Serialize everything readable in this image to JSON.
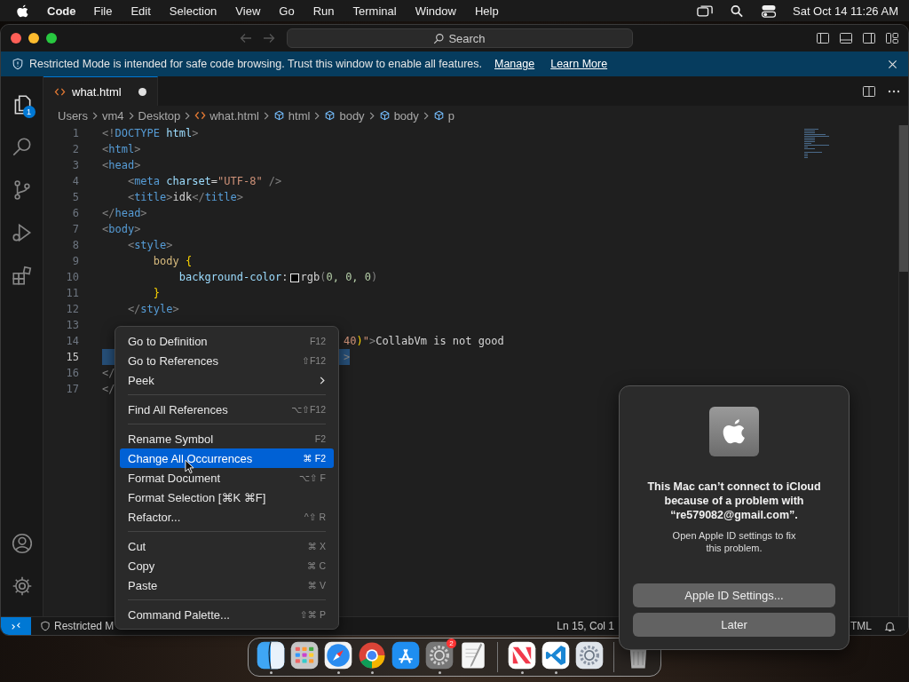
{
  "menubar": {
    "app_name": "Code",
    "menus": [
      "File",
      "Edit",
      "Selection",
      "View",
      "Go",
      "Run",
      "Terminal",
      "Window",
      "Help"
    ],
    "clock": "Sat Oct 14  11:26 AM"
  },
  "titlebar": {
    "search": "Search",
    "back_disabled": true,
    "forward_disabled": true
  },
  "banner": {
    "text": "Restricted Mode is intended for safe code browsing. Trust this window to enable all features.",
    "links": [
      "Manage",
      "Learn More"
    ]
  },
  "activity_bar": [
    {
      "kind": "explorer",
      "selected": true,
      "badge": "1"
    },
    {
      "kind": "search",
      "selected": false
    },
    {
      "kind": "source-control",
      "selected": false
    },
    {
      "kind": "run",
      "selected": false
    },
    {
      "kind": "extensions",
      "selected": false
    }
  ],
  "activity_bottom": [
    {
      "kind": "account"
    },
    {
      "kind": "manage"
    }
  ],
  "tabs": [
    {
      "label": "what.html",
      "selected": true,
      "dirty": true
    }
  ],
  "breadcrumb": [
    {
      "label": "Users",
      "kind": "folder"
    },
    {
      "label": "vm4",
      "kind": "folder"
    },
    {
      "label": "Desktop",
      "kind": "folder"
    },
    {
      "label": "what.html",
      "kind": "file"
    },
    {
      "label": "html",
      "kind": "symbol"
    },
    {
      "label": "body",
      "kind": "symbol"
    },
    {
      "label": "body",
      "kind": "symbol"
    },
    {
      "label": "p",
      "kind": "symbol"
    }
  ],
  "code": [
    {
      "n": "1",
      "tokens": [
        {
          "t": "<!",
          "kind": "punct"
        },
        {
          "t": "DOCTYPE",
          "kind": "tag"
        },
        {
          "t": " html",
          "kind": "attr"
        },
        {
          "t": ">",
          "kind": "punct"
        }
      ]
    },
    {
      "n": "2",
      "tokens": [
        {
          "t": "<",
          "kind": "punct"
        },
        {
          "t": "html",
          "kind": "tag"
        },
        {
          "t": ">",
          "kind": "punct"
        }
      ]
    },
    {
      "n": "3",
      "tokens": [
        {
          "t": "<",
          "kind": "punct"
        },
        {
          "t": "head",
          "kind": "tag"
        },
        {
          "t": ">",
          "kind": "punct"
        }
      ]
    },
    {
      "n": "4",
      "tokens": [
        {
          "t": "    <",
          "kind": "punct"
        },
        {
          "t": "meta",
          "kind": "tag"
        },
        {
          "t": " charset",
          "kind": "attr"
        },
        {
          "t": "=",
          "kind": "text"
        },
        {
          "t": "\"UTF-8\"",
          "kind": "str"
        },
        {
          "t": " />",
          "kind": "punct"
        }
      ]
    },
    {
      "n": "5",
      "tokens": [
        {
          "t": "    <",
          "kind": "punct"
        },
        {
          "t": "title",
          "kind": "tag"
        },
        {
          "t": ">",
          "kind": "punct"
        },
        {
          "t": "idk",
          "kind": "text"
        },
        {
          "t": "</",
          "kind": "punct"
        },
        {
          "t": "title",
          "kind": "tag"
        },
        {
          "t": ">",
          "kind": "punct"
        }
      ]
    },
    {
      "n": "6",
      "tokens": [
        {
          "t": "</",
          "kind": "punct"
        },
        {
          "t": "head",
          "kind": "tag"
        },
        {
          "t": ">",
          "kind": "punct"
        }
      ]
    },
    {
      "n": "7",
      "tokens": [
        {
          "t": "<",
          "kind": "punct"
        },
        {
          "t": "body",
          "kind": "tag"
        },
        {
          "t": ">",
          "kind": "punct"
        }
      ]
    },
    {
      "n": "8",
      "tokens": [
        {
          "t": "    <",
          "kind": "punct"
        },
        {
          "t": "style",
          "kind": "tag"
        },
        {
          "t": ">",
          "kind": "punct"
        }
      ]
    },
    {
      "n": "9",
      "tokens": [
        {
          "t": "        body",
          "kind": "selector"
        },
        {
          "t": " {",
          "kind": "brace"
        }
      ]
    },
    {
      "n": "10",
      "tokens": [
        {
          "t": "            background-color",
          "kind": "attr"
        },
        {
          "t": ":",
          "kind": "text"
        },
        {
          "kind": "swatch"
        },
        {
          "t": "rgb",
          "kind": "text"
        },
        {
          "t": "(",
          "kind": "punct"
        },
        {
          "t": "0, 0, 0",
          "kind": "num"
        },
        {
          "t": ")",
          "kind": "punct"
        }
      ]
    },
    {
      "n": "11",
      "tokens": [
        {
          "t": "        }",
          "kind": "brace"
        }
      ]
    },
    {
      "n": "12",
      "tokens": [
        {
          "t": "    </",
          "kind": "punct"
        },
        {
          "t": "style",
          "kind": "tag"
        },
        {
          "t": ">",
          "kind": "punct"
        }
      ]
    },
    {
      "n": "13"
    },
    {
      "n": "14",
      "covered": true,
      "tokens": [
        {
          "t": "40",
          "kind": "str"
        },
        {
          "t": ")",
          "kind": "brace"
        },
        {
          "t": "\"",
          "kind": "str"
        },
        {
          "t": ">",
          "kind": "punct"
        },
        {
          "t": "CollabVm is not good",
          "kind": "text"
        }
      ]
    },
    {
      "n": "15",
      "covered": true,
      "current": true,
      "selected": true,
      "tokens": [
        {
          "t": ">",
          "kind": "punct"
        }
      ]
    },
    {
      "n": "16",
      "tokens": [
        {
          "t": "</",
          "kind": "punct"
        }
      ]
    },
    {
      "n": "17",
      "tokens": [
        {
          "t": "</",
          "kind": "punct"
        }
      ]
    }
  ],
  "status_bar": {
    "restricted": "Restricted M",
    "position": "Ln 15, Col 1",
    "language": "TML"
  },
  "context_menu": [
    [
      {
        "label": "Go to Definition",
        "shortcut": "F12",
        "selected": false
      },
      {
        "label": "Go to References",
        "shortcut": "⇧F12",
        "selected": false
      },
      {
        "label": "Peek",
        "submenu": true,
        "selected": false
      }
    ],
    [
      {
        "label": "Find All References",
        "shortcut": "⌥⇧F12",
        "selected": false
      }
    ],
    [
      {
        "label": "Rename Symbol",
        "shortcut": "F2",
        "selected": false
      },
      {
        "label": "Change All Occurrences",
        "shortcut": "⌘ F2",
        "selected": true
      },
      {
        "label": "Format Document",
        "shortcut": "⌥⇧ F",
        "selected": false
      },
      {
        "label": "Format Selection [⌘K ⌘F]",
        "selected": false
      },
      {
        "label": "Refactor...",
        "shortcut": "^⇧ R",
        "selected": false
      }
    ],
    [
      {
        "label": "Cut",
        "shortcut": "⌘ X",
        "selected": false
      },
      {
        "label": "Copy",
        "shortcut": "⌘ C",
        "selected": false
      },
      {
        "label": "Paste",
        "shortcut": "⌘ V",
        "selected": false
      }
    ],
    [
      {
        "label": "Command Palette...",
        "shortcut": "⇧⌘ P",
        "selected": false
      }
    ]
  ],
  "dialog": {
    "title": "This Mac can’t connect to iCloud because of a problem with “re579082@gmail.com”.",
    "message": "Open Apple ID settings to fix this problem.",
    "buttons": [
      "Apple ID Settings...",
      "Later"
    ]
  },
  "dock": [
    {
      "kind": "finder",
      "running": true
    },
    {
      "kind": "launchpad",
      "running": false
    },
    {
      "kind": "safari",
      "running": true
    },
    {
      "kind": "chrome",
      "running": true
    },
    {
      "kind": "appstore",
      "running": false
    },
    {
      "kind": "settings",
      "running": true,
      "badge": "2"
    },
    {
      "kind": "textedit",
      "running": false
    },
    {
      "kind": "separator"
    },
    {
      "kind": "news",
      "running": true
    },
    {
      "kind": "vscode",
      "running": true
    },
    {
      "kind": "sysprefs",
      "running": false
    },
    {
      "kind": "separator"
    },
    {
      "kind": "trash",
      "running": false
    }
  ]
}
